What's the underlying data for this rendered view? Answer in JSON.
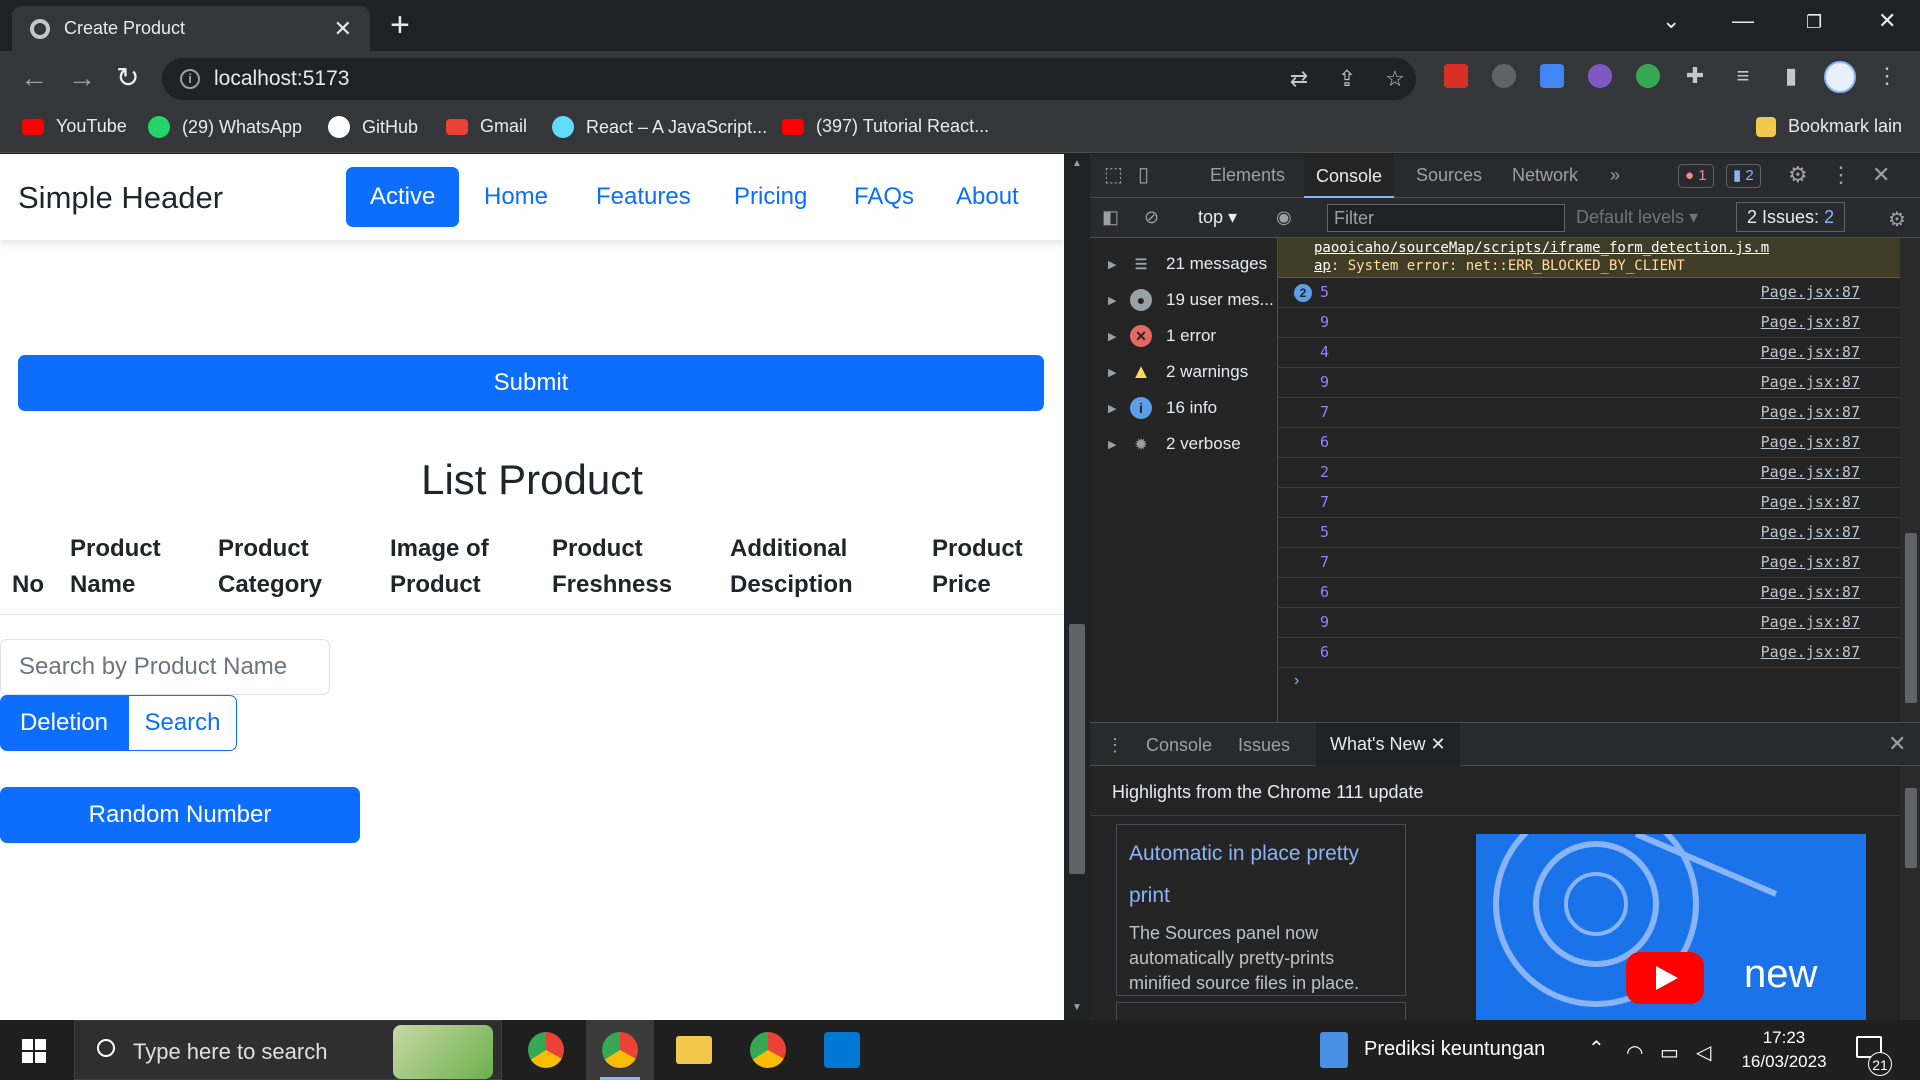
{
  "browser": {
    "tab_title": "Create Product",
    "tab_close": "✕",
    "new_tab": "+",
    "url": "localhost:5173",
    "bookmarks": [
      {
        "label": "YouTube",
        "icon": "youtube-icon",
        "color": "#ff0000"
      },
      {
        "label": "(29) WhatsApp",
        "icon": "whatsapp-icon",
        "color": "#25d366"
      },
      {
        "label": "GitHub",
        "icon": "github-icon",
        "color": "#ffffff"
      },
      {
        "label": "Gmail",
        "icon": "gmail-icon",
        "color": "#ea4335"
      },
      {
        "label": "React – A JavaScript...",
        "icon": "react-icon",
        "color": "#61dafb"
      },
      {
        "label": "(397) Tutorial React...",
        "icon": "youtube-icon",
        "color": "#ff0000"
      }
    ],
    "bookmark_folder": "Bookmark lain"
  },
  "app": {
    "brand": "Simple Header",
    "nav": [
      {
        "label": "Active",
        "active": true
      },
      {
        "label": "Home"
      },
      {
        "label": "Features"
      },
      {
        "label": "Pricing"
      },
      {
        "label": "FAQs"
      },
      {
        "label": "About"
      }
    ],
    "submit_label": "Submit",
    "list_title": "List Product",
    "columns": [
      {
        "line1": "No",
        "line2": ""
      },
      {
        "line1": "Product",
        "line2": "Name"
      },
      {
        "line1": "Product",
        "line2": "Category"
      },
      {
        "line1": "Image of",
        "line2": "Product"
      },
      {
        "line1": "Product",
        "line2": "Freshness"
      },
      {
        "line1": "Additional",
        "line2": "Desciption"
      },
      {
        "line1": "Product",
        "line2": "Price"
      }
    ],
    "search_placeholder": "Search by Product Name",
    "deletion_label": "Deletion",
    "search_label": "Search",
    "random_label": "Random Number",
    "accent_color": "#0d6efd"
  },
  "devtools": {
    "tabs": [
      "Elements",
      "Console",
      "Sources",
      "Network"
    ],
    "selected_tab": "Console",
    "more_tabs": "»",
    "error_badge": "1",
    "message_badge": "2",
    "context": "top",
    "filter_placeholder": "Filter",
    "levels": "Default levels",
    "issues_label": "2 Issues:",
    "issues_count": "2",
    "sidebar": [
      {
        "label": "21 messages",
        "icon": "list-icon"
      },
      {
        "label": "19 user mes...",
        "icon": "user-icon"
      },
      {
        "label": "1 error",
        "icon": "error-icon"
      },
      {
        "label": "2 warnings",
        "icon": "warning-icon"
      },
      {
        "label": "16 info",
        "icon": "info-icon"
      },
      {
        "label": "2 verbose",
        "icon": "bug-icon"
      }
    ],
    "warning_line1": "paooicaho/sourceMap/scripts/iframe_form_detection.js.m",
    "warning_line2_link": "ap",
    "warning_line2_text": ": System error: net::ERR_BLOCKED_BY_CLIENT",
    "logs": [
      {
        "value": "5",
        "count": "2",
        "source": "Page.jsx:87"
      },
      {
        "value": "9",
        "source": "Page.jsx:87"
      },
      {
        "value": "4",
        "source": "Page.jsx:87"
      },
      {
        "value": "9",
        "source": "Page.jsx:87"
      },
      {
        "value": "7",
        "source": "Page.jsx:87"
      },
      {
        "value": "6",
        "source": "Page.jsx:87"
      },
      {
        "value": "2",
        "source": "Page.jsx:87"
      },
      {
        "value": "7",
        "source": "Page.jsx:87"
      },
      {
        "value": "5",
        "source": "Page.jsx:87"
      },
      {
        "value": "7",
        "source": "Page.jsx:87"
      },
      {
        "value": "6",
        "source": "Page.jsx:87"
      },
      {
        "value": "9",
        "source": "Page.jsx:87"
      },
      {
        "value": "6",
        "source": "Page.jsx:87"
      }
    ],
    "prompt": "›",
    "drawer_tabs": [
      "Console",
      "Issues",
      "What's New"
    ],
    "drawer_selected": "What's New",
    "whats_new_headline": "Highlights from the Chrome 111 update",
    "card_title": "Automatic in place pretty print",
    "card_body": "The Sources panel now automatically pretty-prints minified source files in place.",
    "image_caption": "new"
  },
  "taskbar": {
    "search_placeholder": "Type here to search",
    "window_label": "Prediksi keuntungan",
    "time": "17:23",
    "date": "16/03/2023",
    "notification_count": "21"
  }
}
